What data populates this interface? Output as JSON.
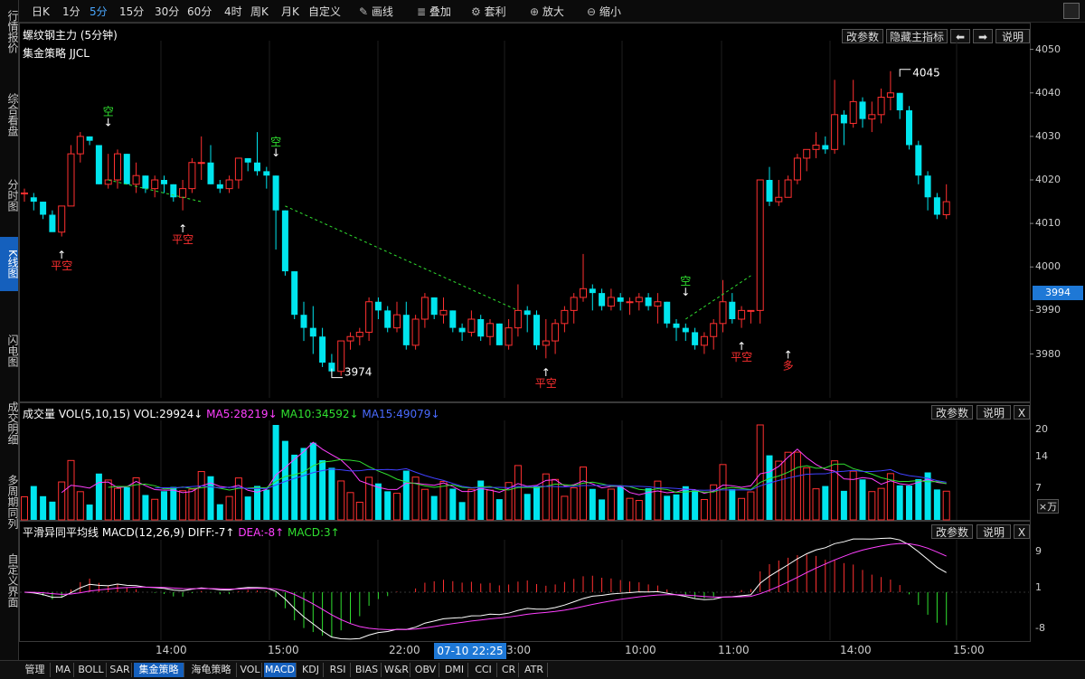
{
  "sidebar": {
    "tabs": [
      {
        "label": "行情报价"
      },
      {
        "label": "综合看盘"
      },
      {
        "label": "分时图"
      },
      {
        "label": "K线图"
      },
      {
        "label": "闪电图"
      },
      {
        "label": "成交明细"
      },
      {
        "label": "多周期同列"
      },
      {
        "label": "自定义界面"
      }
    ],
    "active_index": 3
  },
  "toolbar": {
    "periods": [
      "日K",
      "1分",
      "5分",
      "15分",
      "30分",
      "60分",
      "4时",
      "周K",
      "月K",
      "自定义"
    ],
    "active_period": "5分",
    "tools": [
      {
        "label": "画线",
        "icon": "pencil-icon"
      },
      {
        "label": "叠加",
        "icon": "stack-icon"
      },
      {
        "label": "套利",
        "icon": "arbitrage-icon"
      },
      {
        "label": "放大",
        "icon": "zoom-in-icon"
      },
      {
        "label": "缩小",
        "icon": "zoom-out-icon"
      }
    ]
  },
  "main_panel": {
    "title": "螺纹钢主力 (5分钟)",
    "indicator_title": "集金策略 JJCL",
    "buttons": {
      "params": "改参数",
      "hide_indicator": "隐藏主指标",
      "left": "⬅",
      "right": "➡",
      "help": "说明"
    },
    "price_axis": [
      "4050",
      "4040",
      "4030",
      "4020",
      "4010",
      "4000",
      "3990",
      "3980"
    ],
    "current_price": "3994",
    "high_label": "4045",
    "low_label": "3974",
    "signals": [
      {
        "text": "平空",
        "color": "#ff3030"
      },
      {
        "text": "空",
        "color": "#30e030"
      },
      {
        "text": "平空",
        "color": "#ff3030"
      },
      {
        "text": "空",
        "color": "#30e030"
      },
      {
        "text": "平空",
        "color": "#ff3030"
      },
      {
        "text": "空",
        "color": "#30e030"
      },
      {
        "text": "平空",
        "color": "#ff3030"
      },
      {
        "text": "多",
        "color": "#ff3030"
      }
    ]
  },
  "volume_panel": {
    "title_prefix": "成交量 VOL(5,10,15) VOL:29924↓",
    "ma5": "MA5:28219↓",
    "ma10": "MA10:34592↓",
    "ma15": "MA15:49079↓",
    "axis": [
      "20",
      "14",
      "7"
    ],
    "unit": "×万",
    "buttons": {
      "params": "改参数",
      "help": "说明",
      "close": "X"
    }
  },
  "macd_panel": {
    "title_prefix": "平滑异同平均线 MACD(12,26,9) DIFF:-7↑",
    "dea": "DEA:-8↑",
    "macd": "MACD:3↑",
    "axis": [
      "9",
      "1",
      "-8"
    ],
    "buttons": {
      "params": "改参数",
      "help": "说明",
      "close": "X"
    }
  },
  "time_axis": {
    "labels": [
      "14:00",
      "15:00",
      "22:00",
      "3:00",
      "10:00",
      "11:00",
      "14:00",
      "15:00"
    ],
    "cursor_label": "07-10 22:25"
  },
  "bottom_tabs": [
    "管理",
    "MA",
    "BOLL",
    "SAR",
    "集金策略",
    "海龟策略",
    "VOL",
    "MACD",
    "KDJ",
    "RSI",
    "BIAS",
    "W&R",
    "OBV",
    "DMI",
    "CCI",
    "CR",
    "ATR"
  ],
  "bottom_active": [
    "集金策略",
    "MACD"
  ],
  "colors": {
    "up": "#ff3030",
    "down": "#00e5ee",
    "ma5": "#ff40ff",
    "ma10": "#30e030",
    "ma15": "#4040ff",
    "accent": "#1560bd"
  },
  "chart_data": {
    "type": "candlestick",
    "ylim": [
      3972,
      4052
    ],
    "candles": [
      [
        4017,
        4018,
        4015,
        4017
      ],
      [
        4016,
        4017,
        4013,
        4015
      ],
      [
        4015,
        4015,
        4011,
        4012
      ],
      [
        4012,
        4013,
        4009,
        4008
      ],
      [
        4008,
        4014,
        4007,
        4014
      ],
      [
        4014,
        4028,
        4014,
        4026
      ],
      [
        4026,
        4031,
        4024,
        4030
      ],
      [
        4030,
        4030,
        4028,
        4029
      ],
      [
        4028,
        4028,
        4019,
        4019
      ],
      [
        4019,
        4026,
        4018,
        4020
      ],
      [
        4020,
        4027,
        4018,
        4026
      ],
      [
        4026,
        4026,
        4019,
        4019
      ],
      [
        4019,
        4024,
        4017,
        4021
      ],
      [
        4021,
        4021,
        4017,
        4018
      ],
      [
        4018,
        4021,
        4016,
        4020
      ],
      [
        4020,
        4021,
        4017,
        4019
      ],
      [
        4019,
        4019,
        4015,
        4016
      ],
      [
        4016,
        4020,
        4013,
        4018
      ],
      [
        4018,
        4025,
        4017,
        4024
      ],
      [
        4024,
        4030,
        4020,
        4024
      ],
      [
        4024,
        4028,
        4019,
        4019
      ],
      [
        4019,
        4020,
        4017,
        4018
      ],
      [
        4018,
        4021,
        4017,
        4020
      ],
      [
        4020,
        4025,
        4018,
        4025
      ],
      [
        4025,
        4025,
        4022,
        4024
      ],
      [
        4024,
        4031,
        4021,
        4022
      ],
      [
        4022,
        4023,
        4018,
        4021
      ],
      [
        4021,
        4021,
        4004,
        4013
      ],
      [
        4013,
        4013,
        3998,
        3999
      ],
      [
        3999,
        3999,
        3988,
        3989
      ],
      [
        3989,
        3992,
        3983,
        3986
      ],
      [
        3986,
        3991,
        3980,
        3984
      ],
      [
        3984,
        3986,
        3977,
        3978
      ],
      [
        3978,
        3980,
        3975,
        3976
      ],
      [
        3976,
        3981,
        3975,
        3983
      ],
      [
        3983,
        3985,
        3981,
        3984
      ],
      [
        3984,
        3986,
        3982,
        3985
      ],
      [
        3985,
        3993,
        3983,
        3992
      ],
      [
        3992,
        3993,
        3988,
        3990
      ],
      [
        3990,
        3991,
        3985,
        3986
      ],
      [
        3986,
        3992,
        3985,
        3989
      ],
      [
        3989,
        3992,
        3981,
        3982
      ],
      [
        3982,
        3989,
        3981,
        3988
      ],
      [
        3988,
        3994,
        3986,
        3993
      ],
      [
        3993,
        3993,
        3988,
        3989
      ],
      [
        3989,
        3993,
        3987,
        3990
      ],
      [
        3990,
        3990,
        3985,
        3986
      ],
      [
        3986,
        3987,
        3983,
        3985
      ],
      [
        3985,
        3990,
        3984,
        3988
      ],
      [
        3988,
        3989,
        3983,
        3984
      ],
      [
        3984,
        3988,
        3982,
        3987
      ],
      [
        3987,
        3987,
        3982,
        3982
      ],
      [
        3982,
        3988,
        3981,
        3986
      ],
      [
        3986,
        3996,
        3984,
        3990
      ],
      [
        3990,
        3991,
        3985,
        3989
      ],
      [
        3989,
        3990,
        3981,
        3982
      ],
      [
        3982,
        3988,
        3979,
        3983
      ],
      [
        3983,
        3988,
        3980,
        3987
      ],
      [
        3987,
        3991,
        3985,
        3990
      ],
      [
        3990,
        3994,
        3987,
        3993
      ],
      [
        3993,
        4003,
        3992,
        3995
      ],
      [
        3995,
        3996,
        3990,
        3994
      ],
      [
        3994,
        3995,
        3990,
        3991
      ],
      [
        3991,
        3995,
        3990,
        3993
      ],
      [
        3993,
        3994,
        3990,
        3992
      ],
      [
        3992,
        3993,
        3989,
        3992
      ],
      [
        3992,
        3994,
        3990,
        3993
      ],
      [
        3993,
        3994,
        3990,
        3991
      ],
      [
        3991,
        3994,
        3987,
        3992
      ],
      [
        3992,
        3992,
        3986,
        3987
      ],
      [
        3987,
        3988,
        3983,
        3986
      ],
      [
        3986,
        3987,
        3983,
        3985
      ],
      [
        3985,
        3986,
        3981,
        3982
      ],
      [
        3982,
        3985,
        3980,
        3984
      ],
      [
        3984,
        3988,
        3981,
        3987
      ],
      [
        3987,
        3997,
        3985,
        3992
      ],
      [
        3992,
        3994,
        3987,
        3988
      ],
      [
        3988,
        3991,
        3986,
        3990
      ],
      [
        3990,
        3990,
        3987,
        3990
      ],
      [
        3990,
        4020,
        3987,
        4020
      ],
      [
        4020,
        4023,
        4014,
        4015
      ],
      [
        4015,
        4020,
        4014,
        4016
      ],
      [
        4016,
        4021,
        4016,
        4020
      ],
      [
        4020,
        4026,
        4019,
        4025
      ],
      [
        4025,
        4027,
        4022,
        4027
      ],
      [
        4027,
        4031,
        4025,
        4028
      ],
      [
        4028,
        4030,
        4026,
        4027
      ],
      [
        4027,
        4043,
        4026,
        4035
      ],
      [
        4035,
        4036,
        4028,
        4033
      ],
      [
        4033,
        4043,
        4032,
        4038
      ],
      [
        4038,
        4039,
        4032,
        4034
      ],
      [
        4034,
        4038,
        4031,
        4035
      ],
      [
        4035,
        4041,
        4033,
        4039
      ],
      [
        4039,
        4045,
        4036,
        4040
      ],
      [
        4040,
        4040,
        4034,
        4036
      ],
      [
        4036,
        4037,
        4027,
        4028
      ],
      [
        4028,
        4029,
        4019,
        4021
      ],
      [
        4021,
        4022,
        4013,
        4016
      ],
      [
        4016,
        4017,
        4011,
        4012
      ],
      [
        4012,
        4019,
        4011,
        4015
      ]
    ]
  }
}
